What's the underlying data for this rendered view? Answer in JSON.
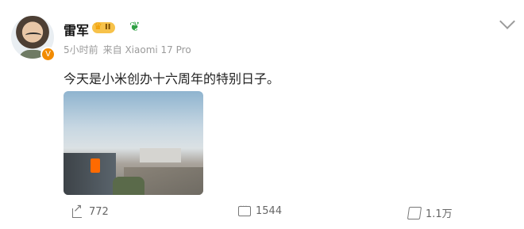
{
  "post": {
    "author": "雷军",
    "level_badge_text": "II",
    "meta": {
      "time": "5小时前",
      "source": "来自 Xiaomi 17 Pro"
    },
    "text": "今天是小米创办十六周年的特别日子。"
  },
  "actions": {
    "reposts": "772",
    "comments": "1544",
    "likes": "1.1万"
  },
  "icons": {
    "avatar": "avatar",
    "verified": "verified-badge",
    "crown": "crown-icon",
    "sprout": "sprout-icon",
    "chevron": "chevron-down-icon",
    "repost": "repost-icon",
    "comment": "comment-icon",
    "like": "like-icon"
  },
  "colors": {
    "orange": "#ff6a00",
    "gold": "#f7c24a",
    "grey": "#9b9b9b"
  }
}
